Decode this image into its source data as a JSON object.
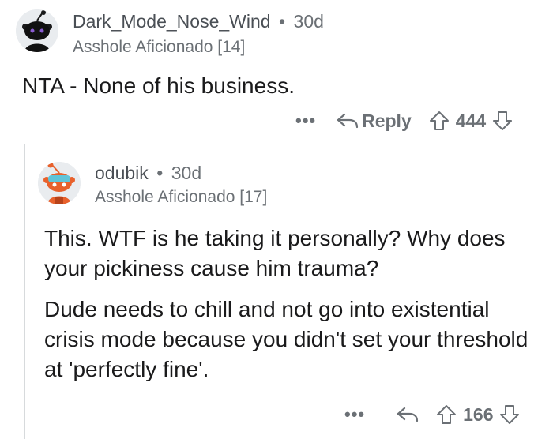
{
  "comments": [
    {
      "username": "Dark_Mode_Nose_Wind",
      "separator": "•",
      "age": "30d",
      "flair": "Asshole Aficionado [14]",
      "body": [
        "NTA - None of his business."
      ],
      "actions": {
        "more": "•••",
        "reply_label": "Reply",
        "score": "444"
      },
      "icons": [
        "avatar",
        "more-icon",
        "reply-icon",
        "upvote-icon",
        "downvote-icon"
      ]
    },
    {
      "username": "odubik",
      "separator": "•",
      "age": "30d",
      "flair": "Asshole Aficionado [17]",
      "body": [
        "This. WTF is he taking it personally? Why does your pickiness cause him trauma?",
        "Dude needs to chill and not go into existential crisis mode because you didn't set your threshold at 'perfectly fine'."
      ],
      "actions": {
        "more": "•••",
        "score": "166"
      },
      "icons": [
        "avatar",
        "more-icon",
        "reply-icon",
        "upvote-icon",
        "downvote-icon"
      ]
    }
  ],
  "colors": {
    "text": "#1a1a1b",
    "meta": "#6b7075",
    "thread_line": "#d7dadc",
    "avatar2_accent": "#e8612c"
  }
}
